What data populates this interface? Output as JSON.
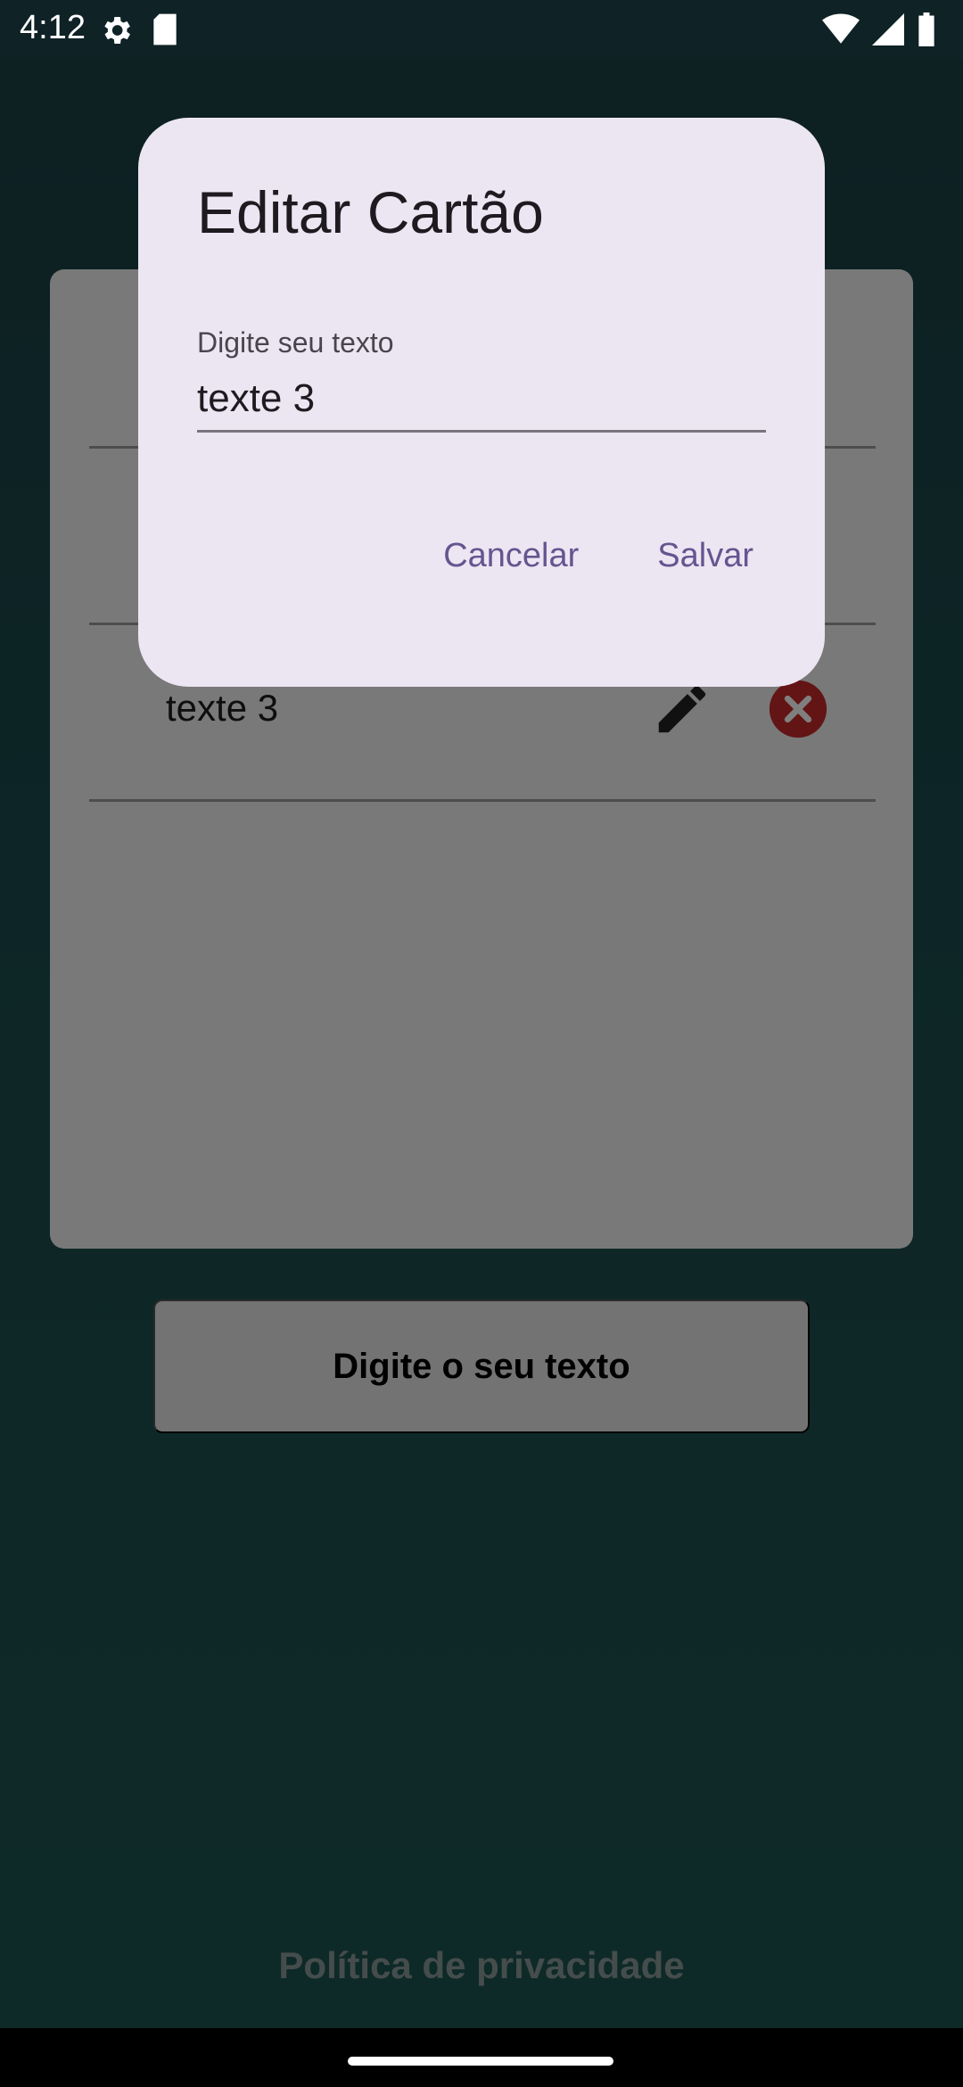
{
  "status_bar": {
    "time": "4:12",
    "icons": [
      "settings-icon",
      "sd-card-icon",
      "wifi-icon",
      "cell-signal-icon",
      "battery-icon"
    ]
  },
  "card_list": {
    "rows": [
      {
        "text": ""
      },
      {
        "text": ""
      },
      {
        "text": "texte 3"
      }
    ]
  },
  "main": {
    "type_button_label": "Digite o seu texto",
    "privacy_link": "Política de privacidade"
  },
  "dialog": {
    "title": "Editar Cartão",
    "field_label": "Digite seu texto",
    "field_value": "texte 3",
    "cancel_label": "Cancelar",
    "save_label": "Salvar"
  },
  "colors": {
    "accent": "#65558f",
    "delete": "#c62828",
    "dialog_bg": "#ece6f3"
  }
}
